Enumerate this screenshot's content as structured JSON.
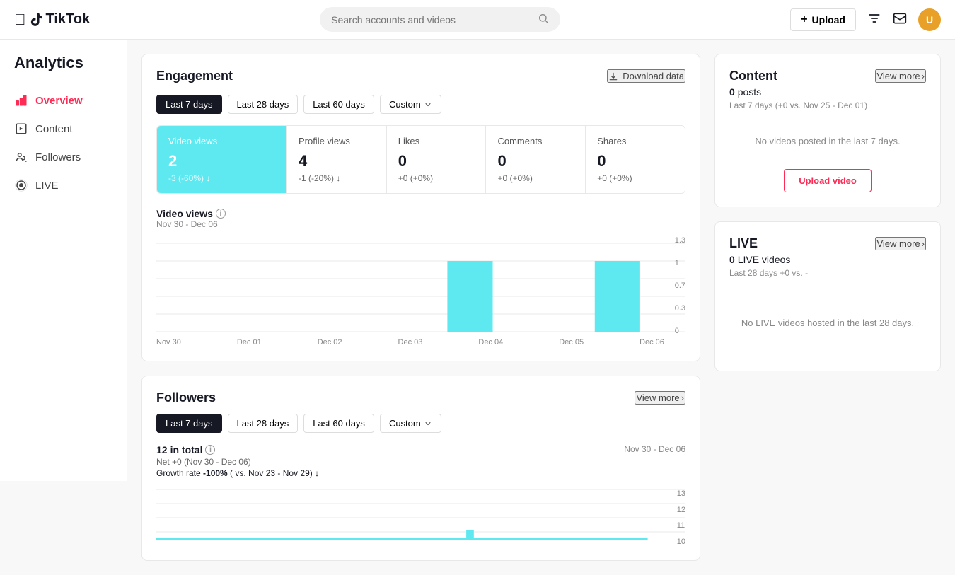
{
  "header": {
    "logo_text": "TikTok",
    "search_placeholder": "Search accounts and videos",
    "upload_label": "Upload"
  },
  "sidebar": {
    "title": "Analytics",
    "items": [
      {
        "id": "overview",
        "label": "Overview",
        "active": true
      },
      {
        "id": "content",
        "label": "Content",
        "active": false
      },
      {
        "id": "followers",
        "label": "Followers",
        "active": false
      },
      {
        "id": "live",
        "label": "LIVE",
        "active": false
      }
    ]
  },
  "engagement": {
    "title": "Engagement",
    "download_label": "Download data",
    "time_filters": [
      "Last 7 days",
      "Last 28 days",
      "Last 60 days"
    ],
    "custom_label": "Custom",
    "active_filter": "Last 7 days",
    "metrics": [
      {
        "label": "Video views",
        "value": "2",
        "change": "-3 (-60%) ↓",
        "highlight": true
      },
      {
        "label": "Profile views",
        "value": "4",
        "change": "-1 (-20%) ↓",
        "highlight": false
      },
      {
        "label": "Likes",
        "value": "0",
        "change": "+0 (+0%)",
        "highlight": false
      },
      {
        "label": "Comments",
        "value": "0",
        "change": "+0 (+0%)",
        "highlight": false
      },
      {
        "label": "Shares",
        "value": "0",
        "change": "+0 (+0%)",
        "highlight": false
      }
    ],
    "chart_title": "Video views",
    "chart_date_range": "Nov 30 - Dec 06",
    "chart_labels": [
      "Nov 30",
      "Dec 01",
      "Dec 02",
      "Dec 03",
      "Dec 04",
      "Dec 05",
      "Dec 06"
    ],
    "chart_values": [
      0,
      0,
      0,
      0,
      1,
      0,
      1
    ],
    "chart_max": 1.3,
    "chart_gridlines": [
      1.3,
      1,
      0.7,
      0.3,
      0
    ]
  },
  "followers_section": {
    "title": "Followers",
    "view_more_label": "View more",
    "time_filters": [
      "Last 7 days",
      "Last 28 days",
      "Last 60 days"
    ],
    "custom_label": "Custom",
    "active_filter": "Last 7 days",
    "total": "12",
    "total_suffix": "in total",
    "net_label": "Net +0 (Nov 30 - Dec 06)",
    "growth_label": "Growth rate -100% ( vs. Nov 23 - Nov 29) ↓",
    "date_range": "Nov 30 - Dec 06",
    "chart_gridlines": [
      13,
      12,
      11,
      10
    ]
  },
  "content_panel": {
    "title": "Content",
    "view_more_label": "View more",
    "posts_count": "0",
    "posts_label": "posts",
    "posts_subtitle": "Last 7 days (+0 vs. Nov 25 - Dec 01)",
    "empty_label": "No videos posted in the last 7 days.",
    "upload_video_label": "Upload video"
  },
  "live_panel": {
    "title": "LIVE",
    "view_more_label": "View more",
    "videos_count": "0",
    "videos_label": "LIVE videos",
    "videos_subtitle": "Last 28 days +0 vs. -",
    "empty_label": "No LIVE videos hosted in the last 28 days."
  }
}
